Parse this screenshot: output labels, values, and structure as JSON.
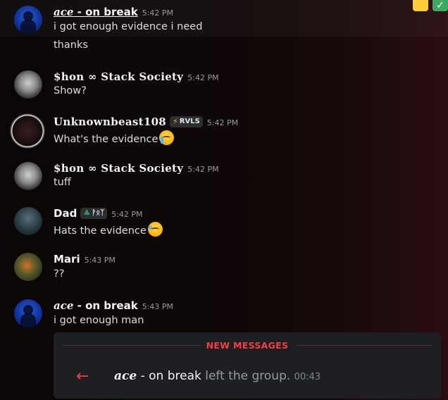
{
  "messages": [
    {
      "name_fancy": "ace",
      "name_rest": " - on break",
      "time": "5:42 PM",
      "lines": [
        "i got enough evidence i need",
        "thanks"
      ]
    },
    {
      "name": "$hon ∞ Stack Society",
      "time": "5:42 PM",
      "text": "Show?"
    },
    {
      "name": "Unknownbeast108",
      "tag": "RVLS",
      "time": "5:42 PM",
      "text": "What's the evidence"
    },
    {
      "name": "$hon ∞ Stack Society",
      "time": "5:42 PM",
      "text": "tuff"
    },
    {
      "name": "Dad",
      "tag": "ᚹᛟᛉ",
      "time": "5:42 PM",
      "text": "Hats the evidence"
    },
    {
      "name": "Mari",
      "time": "5:43 PM",
      "text": "??"
    },
    {
      "name_fancy": "ace",
      "name_rest": " - on break",
      "time": "5:43 PM",
      "text": "i got enough man"
    }
  ],
  "new_messages": {
    "label": "NEW MESSAGES",
    "event_user_fancy": "ace",
    "event_user_rest": " - on break",
    "event_action": " left the group.",
    "event_time": "00:43"
  },
  "colors": {
    "accent_red": "#f23f43",
    "online_green": "#23a55a"
  }
}
